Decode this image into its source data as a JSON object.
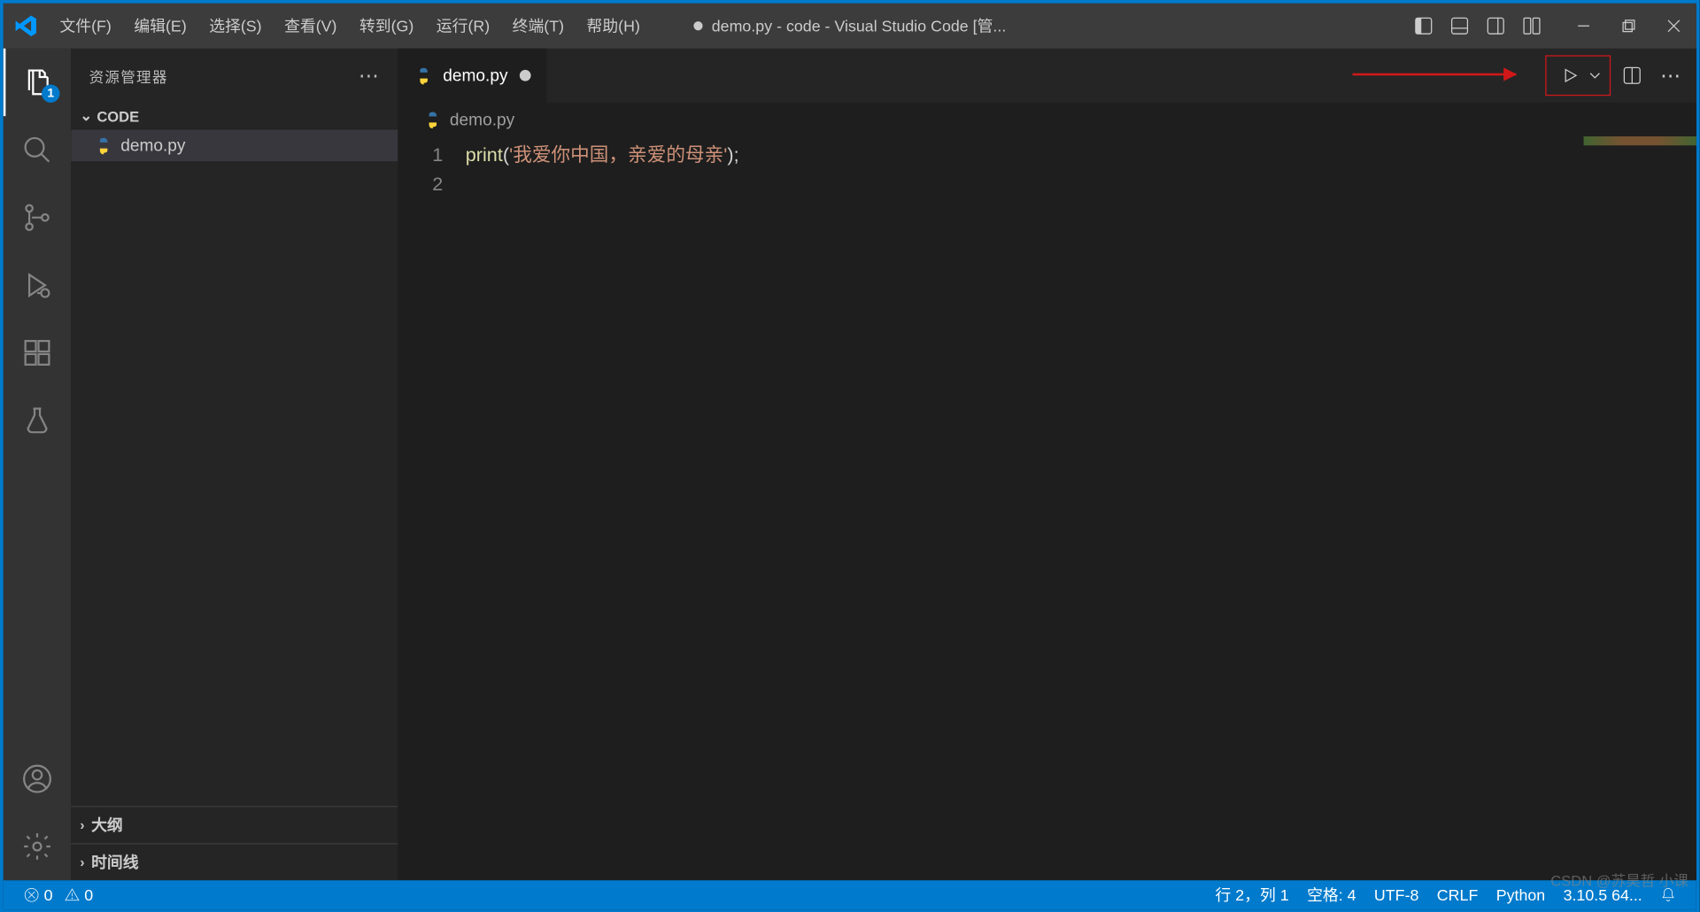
{
  "menu": {
    "file": "文件(F)",
    "edit": "编辑(E)",
    "select": "选择(S)",
    "view": "查看(V)",
    "goto": "转到(G)",
    "run": "运行(R)",
    "terminal": "终端(T)",
    "help": "帮助(H)"
  },
  "title": "demo.py - code - Visual Studio Code [管...",
  "activity": {
    "explorer_badge": "1"
  },
  "sidebar": {
    "title": "资源管理器",
    "folder": "CODE",
    "file1": "demo.py",
    "outline": "大纲",
    "timeline": "时间线"
  },
  "tab": {
    "name": "demo.py"
  },
  "breadcrumb": {
    "file": "demo.py"
  },
  "code": {
    "line1_num": "1",
    "line2_num": "2",
    "fn": "print",
    "open": "(",
    "str": "'我爱你中国，亲爱的母亲'",
    "close": ");"
  },
  "status": {
    "errors": "0",
    "warnings": "0",
    "cursor": "行 2，列 1",
    "spaces": "空格: 4",
    "encoding": "UTF-8",
    "eol": "CRLF",
    "lang": "Python",
    "interp": "3.10.5 64..."
  },
  "watermark": "CSDN @苏昊哲 小课"
}
